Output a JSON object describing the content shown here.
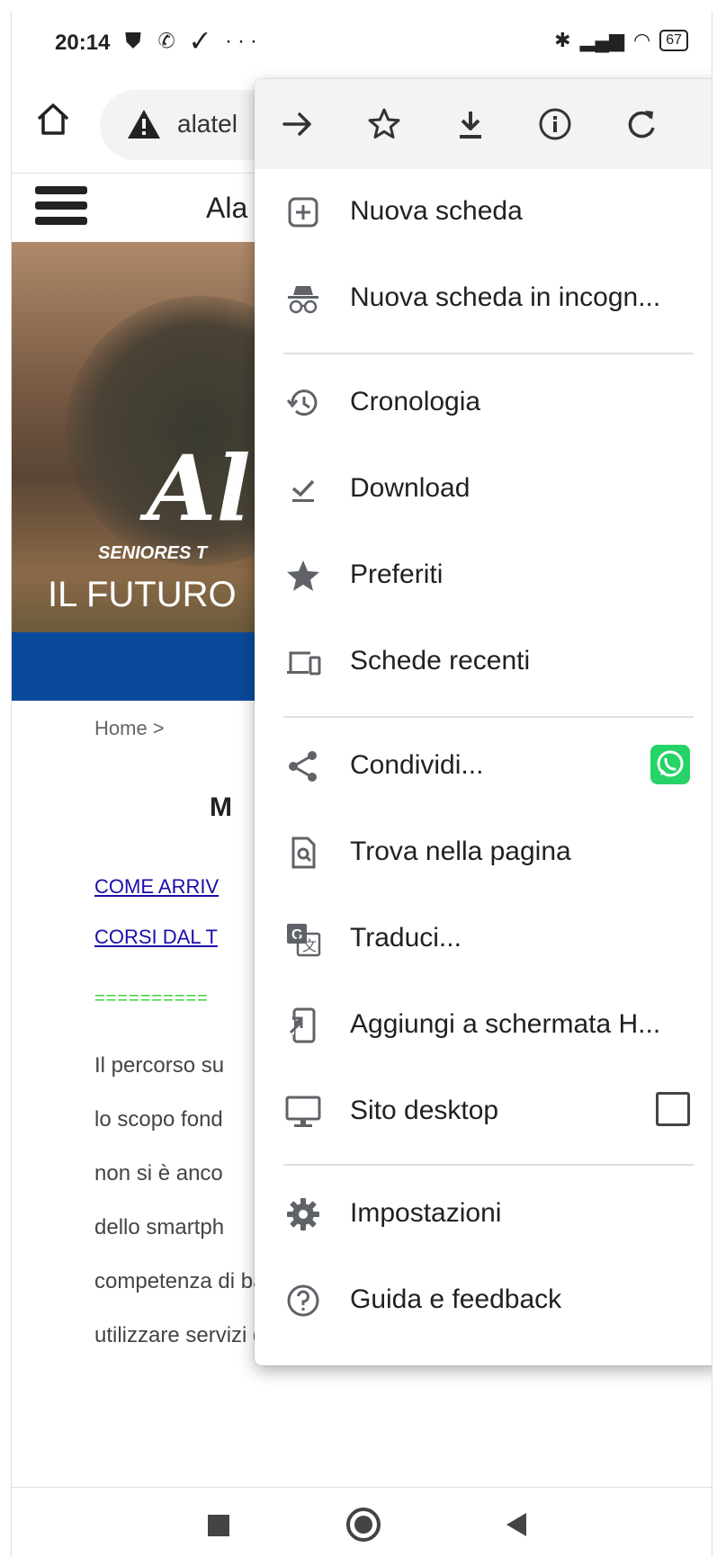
{
  "status_bar": {
    "time": "20:14",
    "left_icons": "⛊ ✆ ✓ ···",
    "battery": "67"
  },
  "omnibox": {
    "url": "alatel"
  },
  "page": {
    "site_title": "Ala",
    "hero_logo": "Al",
    "hero_sub": "SENIORES T",
    "hero_caption": "IL FUTURO",
    "breadcrumb": "Home   >",
    "heading": "M",
    "link1": "COME ARRIV",
    "link2": "CORSI DAL T",
    "separator": "==========",
    "paragraph_lines": [
      "Il percorso su",
      "lo scopo fond",
      "non si è anco",
      "dello smartph",
      "competenza di base sufficiente per poter",
      "utilizzare servizi di base e poter accedere"
    ]
  },
  "menu": {
    "top_icons": [
      "forward-icon",
      "star-icon",
      "download-icon",
      "info-icon",
      "refresh-icon"
    ],
    "items": [
      {
        "label": "Nuova scheda",
        "icon": "new-tab-icon"
      },
      {
        "label": "Nuova scheda in incogn...",
        "icon": "incognito-icon"
      },
      {
        "label": "Cronologia",
        "icon": "history-icon"
      },
      {
        "label": "Download",
        "icon": "downloads-icon"
      },
      {
        "label": "Preferiti",
        "icon": "bookmarks-star-icon"
      },
      {
        "label": "Schede recenti",
        "icon": "recent-tabs-icon"
      },
      {
        "label": "Condividi...",
        "icon": "share-icon"
      },
      {
        "label": "Trova nella pagina",
        "icon": "find-in-page-icon"
      },
      {
        "label": "Traduci...",
        "icon": "translate-icon"
      },
      {
        "label": "Aggiungi a schermata H...",
        "icon": "add-to-home-icon"
      },
      {
        "label": "Sito desktop",
        "icon": "desktop-site-icon",
        "checked": false
      },
      {
        "label": "Impostazioni",
        "icon": "settings-gear-icon"
      },
      {
        "label": "Guida e feedback",
        "icon": "help-icon"
      }
    ]
  },
  "colors": {
    "menu_top_bg": "#f1f3f4",
    "whatsapp": "#25d366",
    "blue_band": "#0a4a9a",
    "link": "#1a0dab"
  }
}
